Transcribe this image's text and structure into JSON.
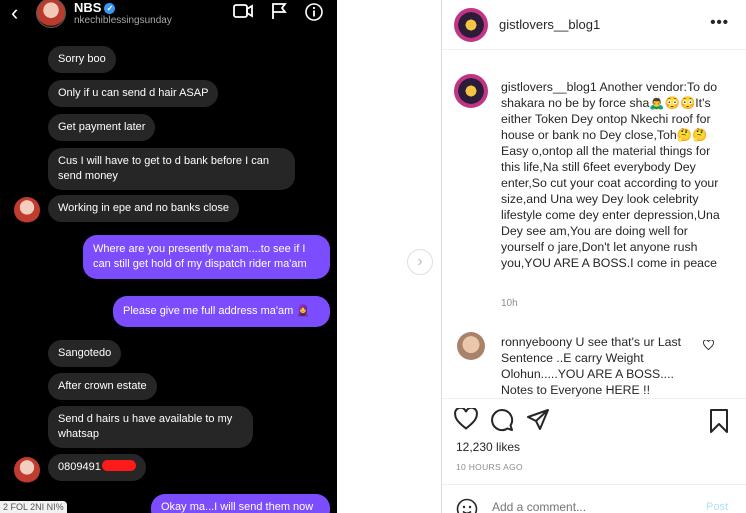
{
  "chat": {
    "back_icon": "chevron-left",
    "contact_name": "NBS",
    "contact_handle": "nkechiblessingsunday",
    "messages": [
      {
        "dir": "in",
        "text": "Sorry boo"
      },
      {
        "dir": "in",
        "text": "Only if u can send d hair ASAP"
      },
      {
        "dir": "in",
        "text": "Get payment later"
      },
      {
        "dir": "in",
        "text": "Cus I will have to get to d bank before I can send money"
      },
      {
        "dir": "in",
        "text": "Working in epe and no banks close"
      },
      {
        "dir": "out",
        "text": "Where are you presently ma'am....to see if I can still get hold of my dispatch rider ma'am"
      },
      {
        "dir": "out",
        "text": "Please give me full address ma'am 🧕"
      },
      {
        "dir": "in",
        "text": "Sangotedo"
      },
      {
        "dir": "in",
        "text": "After crown estate"
      },
      {
        "dir": "in",
        "text": "Send d hairs u have available to my whatsap"
      },
      {
        "dir": "in",
        "text": "0809491"
      },
      {
        "dir": "out",
        "text": "Okay ma...I will send them now"
      }
    ],
    "corner_stamp": "2  FOL 2NI NI%"
  },
  "post": {
    "username": "gistlovers__blog1",
    "caption_user": "gistlovers__blog1",
    "caption_text": "Another vendor:To do shakara no be by force sha🙇‍♂️😳😳It's either Token Dey ontop Nkechi roof for house or bank no Dey close,Toh🤔🤔Easy o,ontop all the material things for this life,Na still 6feet everybody Dey enter,So cut your coat according to your size,and Una wey Dey look celebrity lifestyle come dey enter depression,Una Dey see am,You are doing well for yourself o jare,Don't let anyone rush you,YOU ARE A BOSS.I come in peace",
    "caption_time": "10h",
    "comment_user": "ronnyeboony",
    "comment_text": "U see that's ur Last Sentence ..E carry Weight Olohun.....YOU ARE A BOSS.... Notes to Everyone HERE !!",
    "likes": "12,230 likes",
    "posted_ago": "10 HOURS AGO",
    "add_comment_placeholder": "Add a comment...",
    "post_label": "Post",
    "more_label": "•••",
    "next_label": "›"
  },
  "colors": {
    "outgoing_bubble": "#7c4dff",
    "incoming_bubble": "#262626",
    "verified": "#3897f0"
  }
}
